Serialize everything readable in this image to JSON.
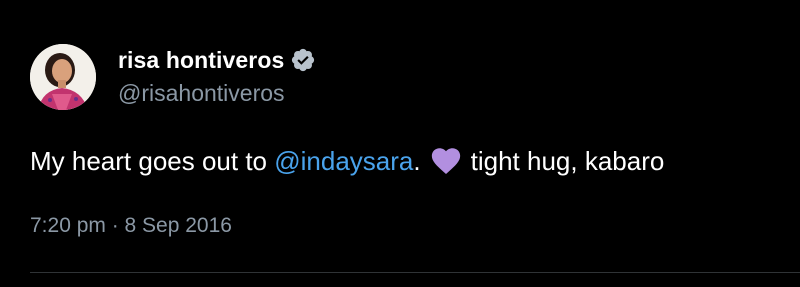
{
  "tweet": {
    "author": {
      "display_name": "risa hontiveros",
      "handle": "@risahontiveros",
      "verified": true,
      "avatar": "profile-photo"
    },
    "text": {
      "before_mention": "My heart goes out to ",
      "mention": "@indaysara",
      "after_mention": ".",
      "emoji": "purple-heart",
      "after_emoji": "tight hug, kabaro"
    },
    "timestamp": "7:20 pm · 8 Sep 2016"
  },
  "colors": {
    "background": "#000000",
    "primary_text": "#ffffff",
    "secondary_text": "#8b98a5",
    "link": "#4aa3ec",
    "verified_badge": "#b8c2cc",
    "heart": "#b28fe0",
    "divider": "#2f3336"
  }
}
